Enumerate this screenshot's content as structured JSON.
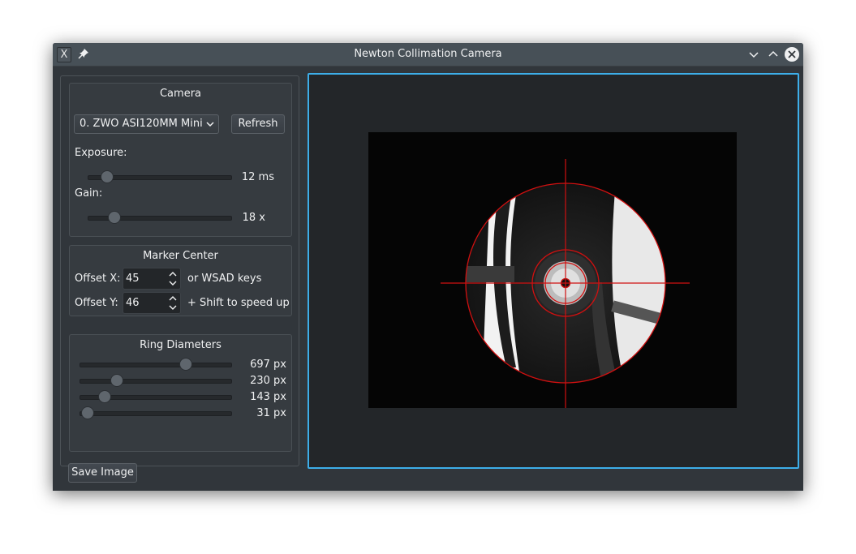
{
  "window": {
    "title": "Newton Collimation Camera",
    "app_icon_glyph": "X"
  },
  "camera": {
    "group_title": "Camera",
    "selected_camera": "0. ZWO ASI120MM Mini",
    "refresh_label": "Refresh",
    "exposure_label": "Exposure:",
    "exposure_value": "12 ms",
    "exposure_level": 0.13,
    "gain_label": "Gain:",
    "gain_value": "18 x",
    "gain_level": 0.18
  },
  "marker": {
    "group_title": "Marker Center",
    "offset_x_label": "Offset X:",
    "offset_x_value": "45",
    "offset_x_hint": "or WSAD keys",
    "offset_y_label": "Offset Y:",
    "offset_y_value": "46",
    "offset_y_hint": "+ Shift to speed up"
  },
  "rings": {
    "group_title": "Ring Diameters",
    "items": [
      {
        "value": "697 px",
        "level": 0.69
      },
      {
        "value": "230 px",
        "level": 0.24
      },
      {
        "value": "143 px",
        "level": 0.16
      },
      {
        "value": "31 px",
        "level": 0.05
      }
    ]
  },
  "save_label": "Save Image",
  "colors": {
    "accent": "#3daee9",
    "window_bg": "#31363b",
    "marker_red": "#d01010"
  },
  "icons": [
    "x-app-icon",
    "pin-icon",
    "minimize-icon",
    "maximize-icon",
    "close-icon",
    "chevron-down-icon",
    "spin-arrows-icon"
  ]
}
